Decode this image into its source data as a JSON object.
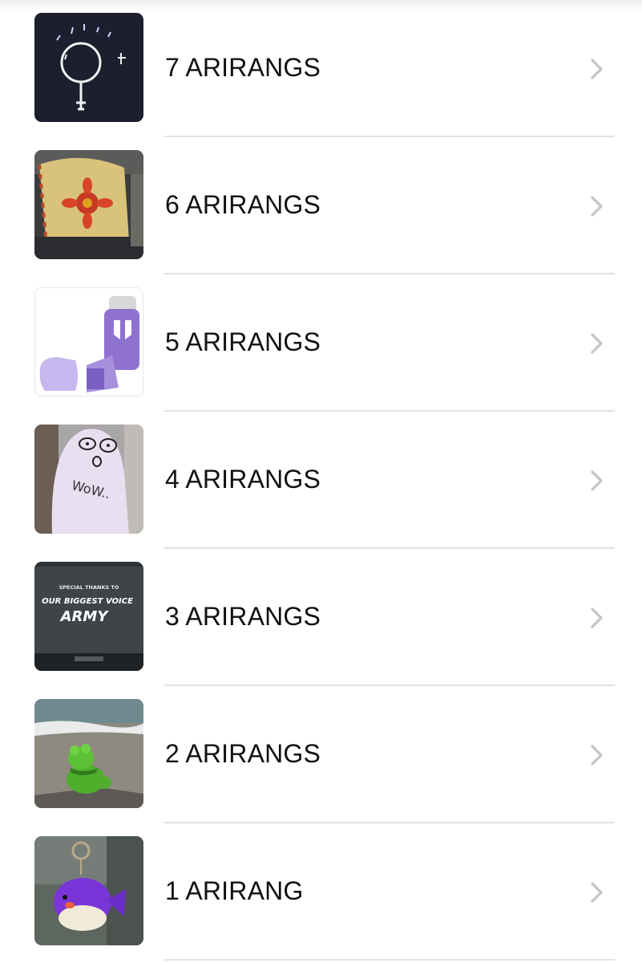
{
  "items": [
    {
      "label": "7 ARIRANGS",
      "thumb": "doodle-sketch-image",
      "caption": ""
    },
    {
      "label": "6 ARIRANGS",
      "thumb": "flower-pouch-image",
      "caption": ""
    },
    {
      "label": "5 ARIRANGS",
      "thumb": "purple-inhaler-image",
      "caption": ""
    },
    {
      "label": "4 ARIRANGS",
      "thumb": "wow-face-lightstick-image",
      "caption": "WoW.."
    },
    {
      "label": "3 ARIRANGS",
      "thumb": "army-screen-image",
      "caption": "SPECIAL THANKS TO",
      "caption2": "OUR BIGGEST VOICE",
      "caption3": "ARMY"
    },
    {
      "label": "2 ARIRANGS",
      "thumb": "frog-at-beach-image",
      "caption": ""
    },
    {
      "label": "1 ARIRANG",
      "thumb": "purple-fish-keychain-image",
      "caption": ""
    }
  ],
  "chevron_icon": "chevron-right-icon",
  "colors": {
    "text": "#111111",
    "chevron": "#c4c4c7",
    "separator": "#e3e3e6"
  }
}
